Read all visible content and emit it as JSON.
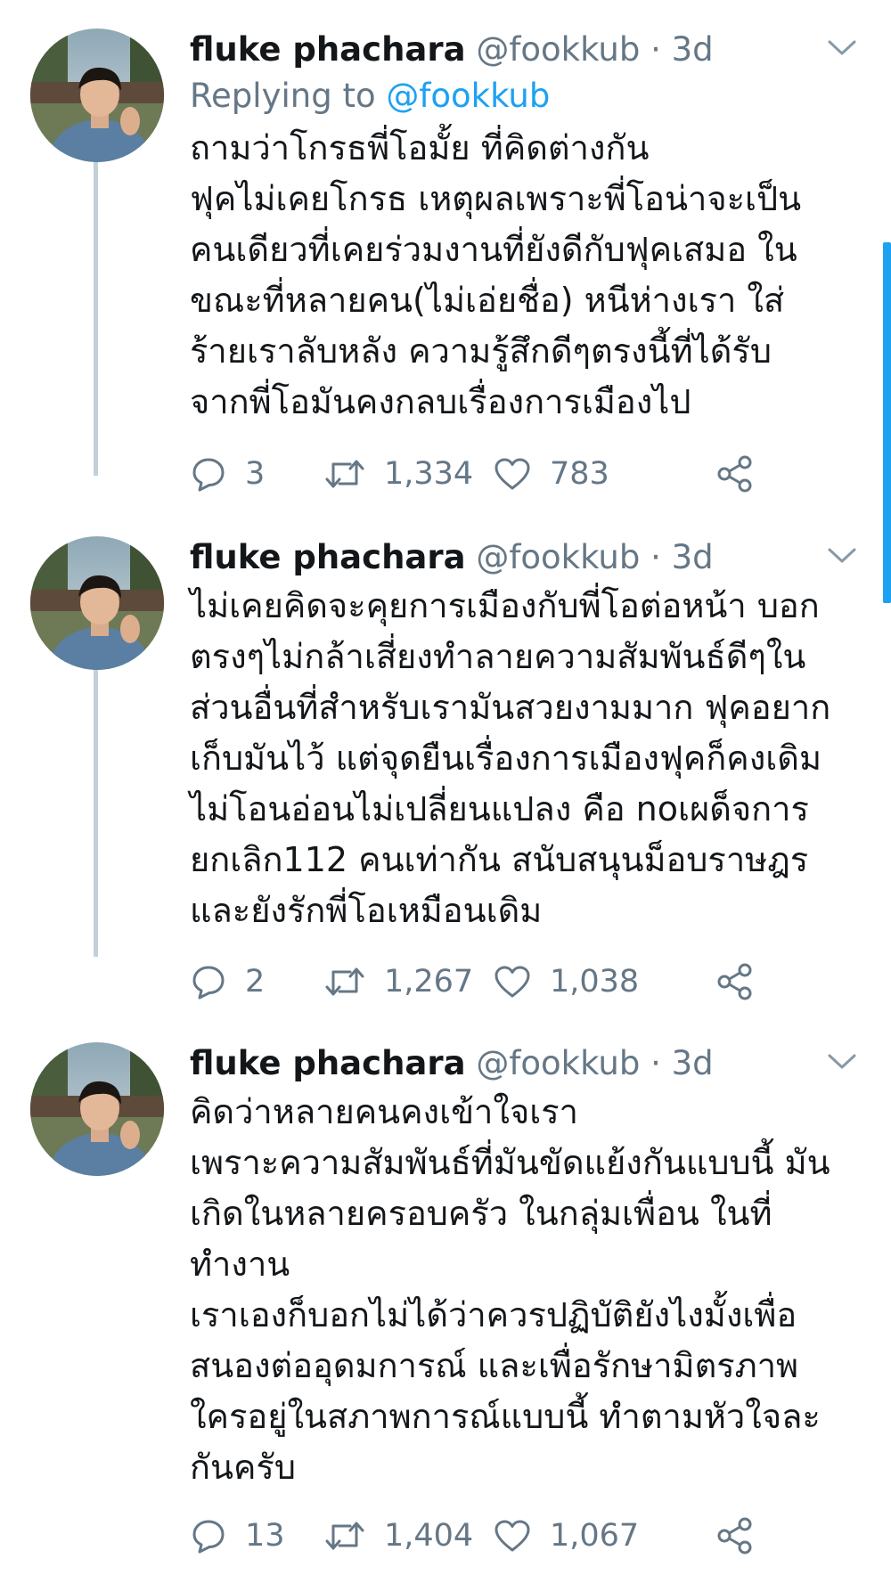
{
  "tweets": [
    {
      "name": "fluke phachara",
      "handle": "@fookkub",
      "separator": "·",
      "time": "3d",
      "reply_prefix": "Replying to",
      "reply_mention": "@fookkub",
      "lines": [
        "ถามว่าโกรธพี่โอมั้ย ที่คิดต่างกัน",
        "ฟุคไม่เคยโกรธ เหตุผลเพราะพี่โอน่าจะเป็น",
        "คนเดียวที่เคยร่วมงานที่ยังดีกับฟุคเสมอ ใน",
        "ขณะที่หลายคน(ไม่เอ่ยชื่อ) หนีห่างเรา ใส่",
        "ร้ายเราลับหลัง ความรู้สึกดีๆตรงนี้ที่ได้รับ",
        "จากพี่โอมันคงกลบเรื่องการเมืองไป"
      ],
      "replies": "3",
      "retweets": "1,334",
      "likes": "783"
    },
    {
      "name": "fluke phachara",
      "handle": "@fookkub",
      "separator": "·",
      "time": "3d",
      "lines": [
        "ไม่เคยคิดจะคุยการเมืองกับพี่โอต่อหน้า บอก",
        "ตรงๆไม่กล้าเสี่ยงทำลายความสัมพันธ์ดีๆใน",
        "ส่วนอื่นที่สำหรับเรามันสวยงามมาก ฟุคอยาก",
        "เก็บมันไว้ แต่จุดยืนเรื่องการเมืองฟุคก็คงเดิม",
        "ไม่โอนอ่อนไม่เปลี่ยนแปลง คือ noเผด็จการ",
        "ยกเลิก112 คนเท่ากัน สนับสนุนม็อบราษฎร",
        "และยังรักพี่โอเหมือนเดิม"
      ],
      "replies": "2",
      "retweets": "1,267",
      "likes": "1,038"
    },
    {
      "name": "fluke phachara",
      "handle": "@fookkub",
      "separator": "·",
      "time": "3d",
      "lines": [
        "คิดว่าหลายคนคงเข้าใจเรา",
        "เพราะความสัมพันธ์ที่มันขัดแย้งกันแบบนี้ มัน",
        "เกิดในหลายครอบครัว ในกลุ่มเพื่อน ในที่",
        "ทำงาน",
        "เราเองก็บอกไม่ได้ว่าควรปฏิบัติยังไงมั้งเพื่อ",
        "สนองต่ออุดมการณ์ และเพื่อรักษามิตรภาพ",
        "ใครอยู่ในสภาพการณ์แบบนี้ ทำตามหัวใจละ",
        "กันครับ"
      ],
      "replies": "13",
      "retweets": "1,404",
      "likes": "1,067"
    }
  ],
  "icons": {
    "reply": "speech-bubble-icon",
    "retweet": "retweet-arrows-icon",
    "like": "heart-outline-icon",
    "share": "share-nodes-icon",
    "more": "chevron-down-icon"
  },
  "colors": {
    "text": "#14171a",
    "secondary": "#657786",
    "accent": "#1da1f2",
    "thread_line": "#c4cfd6"
  }
}
